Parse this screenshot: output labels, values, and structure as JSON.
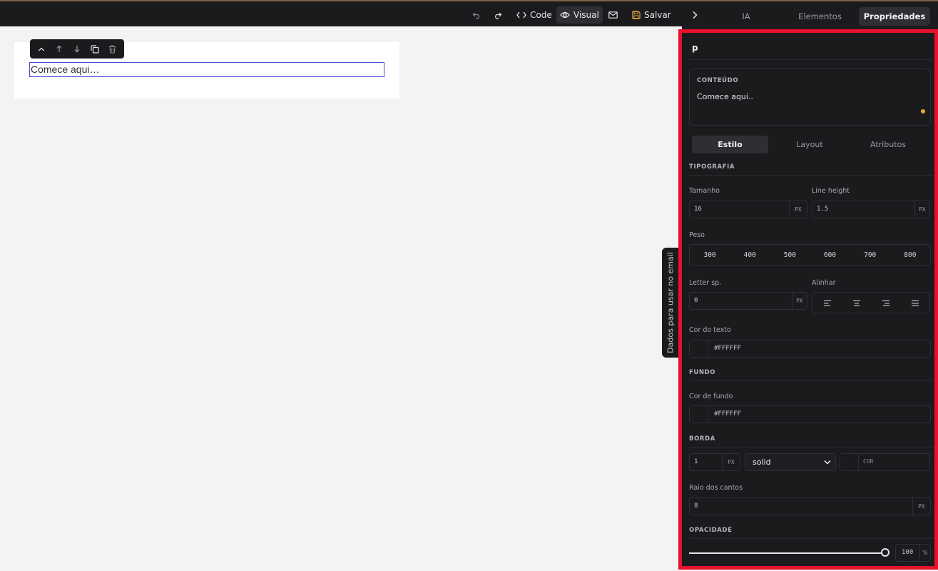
{
  "toolbar": {
    "code_label": "Code",
    "visual_label": "Visual",
    "save_label": "Salvar"
  },
  "canvas": {
    "paragraph_text": "Comece aqui…"
  },
  "side_tab": {
    "label": "Dados para usar no email"
  },
  "panel_tabs": [
    {
      "label": "IA"
    },
    {
      "label": "Elementos"
    },
    {
      "label": "Propriedades"
    }
  ],
  "properties": {
    "element_tag": "p",
    "content": {
      "label": "CONTEÚDO",
      "value": "Comece aqui.."
    },
    "subtabs": [
      {
        "label": "Estilo"
      },
      {
        "label": "Layout"
      },
      {
        "label": "Atributos"
      }
    ],
    "typography": {
      "section": "TIPOGRAFIA",
      "size_label": "Tamanho",
      "size_value": "16",
      "size_unit": "PX",
      "line_height_label": "Line height",
      "line_height_value": "1.5",
      "line_height_unit": "PX",
      "weight_label": "Peso",
      "weights": [
        "300",
        "400",
        "500",
        "600",
        "700",
        "800"
      ],
      "letter_spacing_label": "Letter sp.",
      "letter_spacing_value": "0",
      "letter_spacing_unit": "PX",
      "align_label": "Alinhar",
      "text_color_label": "Cor do texto",
      "text_color_value": "#FFFFFF"
    },
    "background": {
      "section": "FUNDO",
      "color_label": "Cor de fundo",
      "color_value": "#FFFFFF"
    },
    "border": {
      "section": "BORDA",
      "width_value": "1",
      "width_unit": "PX",
      "style_value": "solid",
      "color_placeholder": "COR",
      "radius_label": "Raio dos cantos",
      "radius_value": "8",
      "radius_unit": "PX"
    },
    "opacity": {
      "section": "OPACIDADE",
      "value": "100",
      "unit": "%",
      "level": 1.0
    }
  },
  "colors": {
    "accent_save": "#e5a93a",
    "panel_highlight": "#e8102a",
    "selection_outline": "#4a4ad0"
  }
}
